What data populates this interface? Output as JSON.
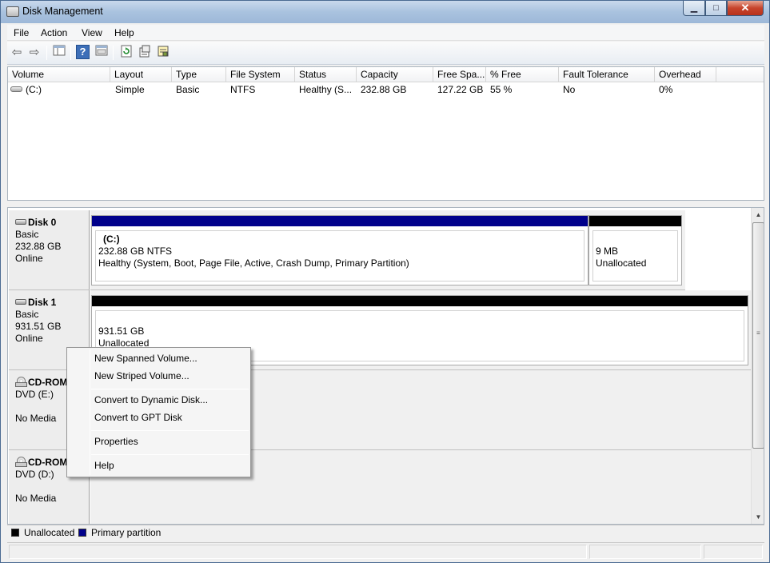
{
  "window": {
    "title": "Disk Management",
    "minimize": "▁",
    "maximize": "□",
    "close": "✕"
  },
  "menu": [
    "File",
    "Action",
    "View",
    "Help"
  ],
  "toolbar": {
    "buttons": [
      "back-icon",
      "forward-icon",
      "console-tree-icon",
      "help-icon",
      "show-pane-icon",
      "refresh-icon",
      "properties-icon",
      "export-icon"
    ],
    "help_glyph": "?"
  },
  "volume_list": {
    "columns": [
      "Volume",
      "Layout",
      "Type",
      "File System",
      "Status",
      "Capacity",
      "Free Spa...",
      "% Free",
      "Fault Tolerance",
      "Overhead"
    ],
    "rows": [
      {
        "volume": "(C:)",
        "layout": "Simple",
        "type": "Basic",
        "fs": "NTFS",
        "status": "Healthy (S...",
        "capacity": "232.88 GB",
        "free": "127.22 GB",
        "pct_free": "55 %",
        "fault": "No",
        "overhead": "0%"
      }
    ]
  },
  "disks": [
    {
      "name": "Disk 0",
      "kind": "Basic",
      "size": "232.88 GB",
      "state": "Online",
      "partitions": [
        {
          "label": "(C:)",
          "line1": "232.88 GB NTFS",
          "line2": "Healthy (System, Boot, Page File, Active, Crash Dump, Primary Partition)",
          "kind": "primary"
        },
        {
          "line1": "9 MB",
          "line2": "Unallocated",
          "kind": "unallocated"
        }
      ]
    },
    {
      "name": "Disk 1",
      "kind": "Basic",
      "size": "931.51 GB",
      "state": "Online",
      "partitions": [
        {
          "line1": "931.51 GB",
          "line2": "Unallocated",
          "kind": "unallocated"
        }
      ]
    },
    {
      "name": "CD-ROM 0",
      "kind": "DVD (E:)",
      "state": "No Media"
    },
    {
      "name": "CD-ROM 1",
      "kind": "DVD (D:)",
      "state": "No Media"
    }
  ],
  "legend": {
    "unallocated": "Unallocated",
    "primary": "Primary partition"
  },
  "colors": {
    "primary": "#00008b",
    "unallocated": "#000000"
  },
  "context_menu": {
    "new_spanned": "New Spanned Volume...",
    "new_striped": "New Striped Volume...",
    "convert_dynamic": "Convert to Dynamic Disk...",
    "convert_gpt": "Convert to GPT Disk",
    "properties": "Properties",
    "help": "Help"
  }
}
